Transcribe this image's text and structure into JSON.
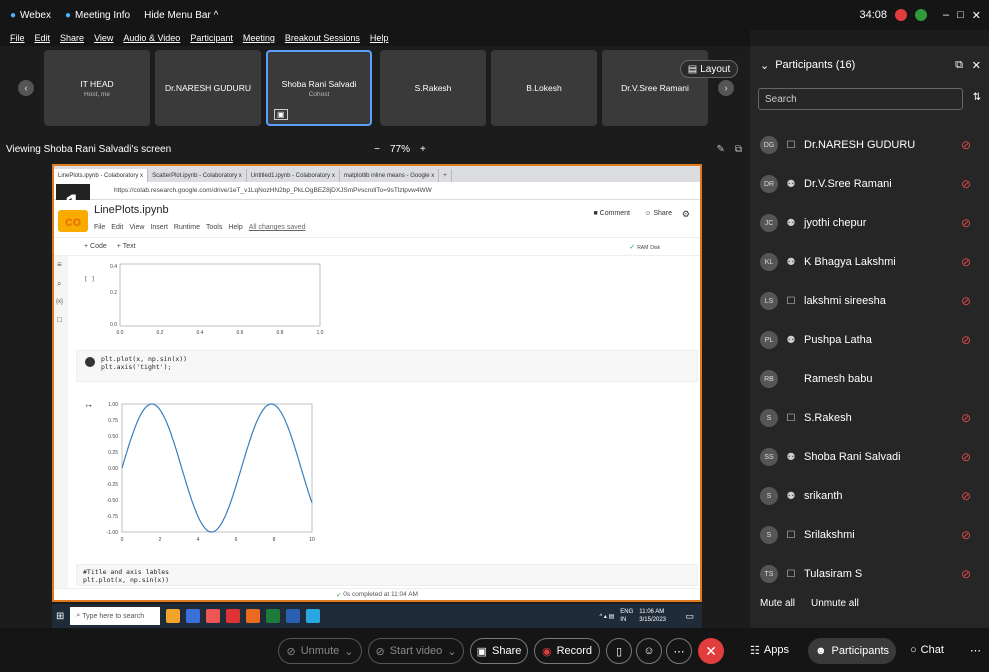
{
  "topbar": {
    "app": "Webex",
    "meeting_info": "Meeting Info",
    "hide_menu": "Hide Menu Bar ^",
    "timer": "34:08"
  },
  "menu": [
    "File",
    "Edit",
    "Share",
    "View",
    "Audio & Video",
    "Participant",
    "Meeting",
    "Breakout Sessions",
    "Help"
  ],
  "tiles": [
    {
      "name": "IT HEAD",
      "sub": "Host, me"
    },
    {
      "name": "Dr.NARESH GUDURU",
      "sub": ""
    },
    {
      "name": "Shoba Rani Salvadi",
      "sub": "Cohost"
    },
    {
      "name": "S.Rakesh",
      "sub": ""
    },
    {
      "name": "B.Lokesh",
      "sub": ""
    },
    {
      "name": "Dr.V.Sree Ramani",
      "sub": ""
    }
  ],
  "layout_label": "Layout",
  "viewing": "Viewing Shoba Rani Salvadi's screen",
  "zoom": "77%",
  "zoom_minus": "−",
  "zoom_plus": "+",
  "browser": {
    "tabs": [
      "LinePlots.ipynb - Colaboratory",
      "ScatterPlot.ipynb - Colaboratory",
      "Untitled1.ipynb - Colaboratory",
      "matplotlib inline means - Google"
    ],
    "url": "https://colab.research.google.com/drive/1eT_v1LqNozHN2bp_PkLOgBEZ8jDXJSmP#scrollTo=9sTlztpvw4WW",
    "title": "LinePlots.ipynb",
    "menu": [
      "File",
      "Edit",
      "View",
      "Insert",
      "Runtime",
      "Tools",
      "Help"
    ],
    "saved": "All changes saved",
    "comment": "Comment",
    "share": "Share",
    "add_code": "+ Code",
    "add_text": "+ Text",
    "ram": "RAM",
    "disk": "Disk",
    "code1": "plt.plot(x, np.sin(x))\nplt.axis('tight');",
    "code2": "#Title and axis lables\nplt.plot(x, np.sin(x))",
    "status": "0s   completed at 11:04 AM",
    "big_num": "1"
  },
  "chart_data": {
    "type": "line",
    "x_range": [
      0,
      10
    ],
    "ylim": [
      -1,
      1
    ],
    "series": [
      {
        "values": "sin(x)"
      }
    ],
    "yticks": [
      "1.00",
      "0.75",
      "0.50",
      "0.25",
      "0.00",
      "-0.25",
      "-0.50",
      "-0.75",
      "-1.00"
    ],
    "xticks": [
      "0",
      "2",
      "4",
      "6",
      "8",
      "10"
    ],
    "upper_yticks": [
      "0.4",
      "0.2",
      "0.0"
    ],
    "upper_xticks": [
      "0.0",
      "0.2",
      "0.4",
      "0.6",
      "0.8",
      "1.0"
    ]
  },
  "taskbar": {
    "search": "Type here to search",
    "lang": "ENG",
    "region": "IN",
    "time": "11:06 AM",
    "date": "3/15/2023"
  },
  "participants": {
    "header": "Participants (16)",
    "search_placeholder": "Search",
    "list": [
      {
        "initials": "DG",
        "name": "Dr.NARESH GUDURU",
        "device": "☐"
      },
      {
        "initials": "DR",
        "name": "Dr.V.Sree Ramani",
        "device": "⚉"
      },
      {
        "initials": "JC",
        "name": "jyothi chepur",
        "device": "⚉"
      },
      {
        "initials": "KL",
        "name": "K Bhagya Lakshmi",
        "device": "⚉"
      },
      {
        "initials": "LS",
        "name": "lakshmi sireesha",
        "device": "☐"
      },
      {
        "initials": "PL",
        "name": "Pushpa Latha",
        "device": "⚉"
      },
      {
        "initials": "RB",
        "name": "Ramesh babu",
        "device": ""
      },
      {
        "initials": "S",
        "name": "S.Rakesh",
        "device": "☐"
      },
      {
        "initials": "SS",
        "name": "Shoba Rani Salvadi",
        "device": "⚉"
      },
      {
        "initials": "S",
        "name": "srikanth",
        "device": "⚉"
      },
      {
        "initials": "S",
        "name": "Srilakshmi",
        "device": "☐"
      },
      {
        "initials": "TS",
        "name": "Tulasiram S",
        "device": "☐"
      }
    ],
    "mute_all": "Mute all",
    "unmute_all": "Unmute all"
  },
  "controls": {
    "unmute": "Unmute",
    "start_video": "Start video",
    "share": "Share",
    "record": "Record",
    "apps": "Apps",
    "participants": "Participants",
    "chat": "Chat"
  }
}
